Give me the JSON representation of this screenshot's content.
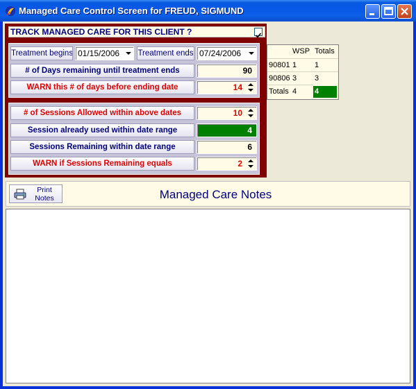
{
  "window": {
    "title": "Managed Care Control Screen for FREUD, SIGMUND"
  },
  "track": {
    "label": "TRACK MANAGED CARE FOR THIS CLIENT ?",
    "checked": true
  },
  "treatment": {
    "begins_label": "Treatment begins",
    "begins_value": "01/15/2006",
    "ends_label": "Treatment ends",
    "ends_value": "07/24/2006"
  },
  "days": {
    "remaining_label": "# of Days remaining until treatment ends",
    "remaining_value": "90",
    "warn_label": "WARN this # of days before ending date",
    "warn_value": "14"
  },
  "sessions": {
    "allowed_label": "# of Sessions Allowed within above dates",
    "allowed_value": "10",
    "used_label": "Session already used within date range",
    "used_value": "4",
    "remaining_label": "Sessions Remaining within date range",
    "remaining_value": "6",
    "warn_label": "WARN if Sessions Remaining equals",
    "warn_value": "2"
  },
  "summary_grid": {
    "headers": [
      "",
      "WSP",
      "Totals"
    ],
    "rows": [
      [
        "90801",
        "1",
        "1"
      ],
      [
        "90806",
        "3",
        "3"
      ],
      [
        "Totals",
        "4",
        "4"
      ]
    ]
  },
  "notes": {
    "print_label_line1": "Print",
    "print_label_line2": "Notes",
    "title": "Managed Care Notes",
    "content": ""
  },
  "colors": {
    "maroon": "#800000",
    "accent_red": "#e00000",
    "navy": "#000080",
    "green": "#008000",
    "cream": "#fffbe6"
  },
  "icons": [
    "app-icon",
    "minimize-icon",
    "maximize-icon",
    "close-icon",
    "checkmark-icon",
    "dropdown-arrow-icon",
    "spinner-icon",
    "printer-icon"
  ]
}
